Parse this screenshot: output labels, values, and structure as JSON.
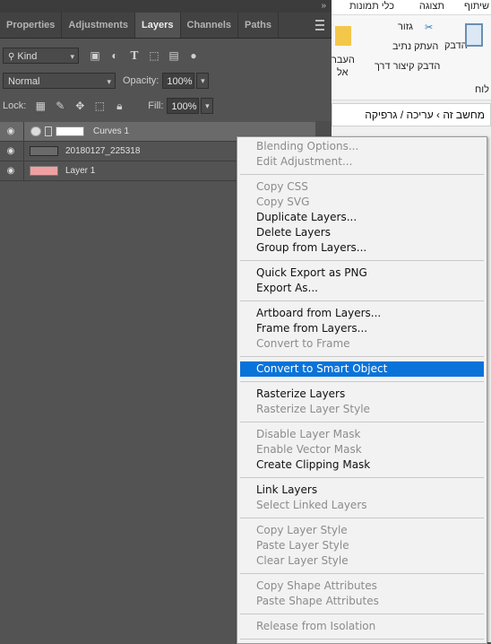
{
  "panel_tabs": [
    "Properties",
    "Adjustments",
    "Layers",
    "Channels",
    "Paths"
  ],
  "active_tab": "Layers",
  "filter": {
    "label": "Kind"
  },
  "blend_mode": "Normal",
  "opacity": {
    "label": "Opacity:",
    "value": "100%"
  },
  "lock": {
    "label": "Lock:"
  },
  "fill": {
    "label": "Fill:",
    "value": "100%"
  },
  "layers": [
    {
      "name": "Curves 1",
      "selected": true
    },
    {
      "name": "20180127_225318",
      "selected": false
    },
    {
      "name": "Layer 1",
      "selected": false
    }
  ],
  "explorer": {
    "tabs": [
      "שיתוף",
      "תצוגה",
      "כלי תמונות"
    ],
    "cut": "גזור",
    "copy_path": "העתק נתיב",
    "paste_shortcut": "הדבק קיצור דרך",
    "paste": "הדבק",
    "move_to": "העבר",
    "move_to_2": "אל",
    "clipboard": "לוח",
    "address": "מחשב זה  ›  עריכה / גרפיקה"
  },
  "menu": [
    {
      "label": "Blending Options...",
      "enabled": false
    },
    {
      "label": "Edit Adjustment...",
      "enabled": false
    },
    {
      "sep": true
    },
    {
      "label": "Copy CSS",
      "enabled": false
    },
    {
      "label": "Copy SVG",
      "enabled": false
    },
    {
      "label": "Duplicate Layers...",
      "enabled": true
    },
    {
      "label": "Delete Layers",
      "enabled": true
    },
    {
      "label": "Group from Layers...",
      "enabled": true
    },
    {
      "sep": true
    },
    {
      "label": "Quick Export as PNG",
      "enabled": true
    },
    {
      "label": "Export As...",
      "enabled": true
    },
    {
      "sep": true
    },
    {
      "label": "Artboard from Layers...",
      "enabled": true
    },
    {
      "label": "Frame from Layers...",
      "enabled": true
    },
    {
      "label": "Convert to Frame",
      "enabled": false
    },
    {
      "sep": true
    },
    {
      "label": "Convert to Smart Object",
      "enabled": true,
      "highlighted": true
    },
    {
      "sep": true
    },
    {
      "label": "Rasterize Layers",
      "enabled": true
    },
    {
      "label": "Rasterize Layer Style",
      "enabled": false
    },
    {
      "sep": true
    },
    {
      "label": "Disable Layer Mask",
      "enabled": false
    },
    {
      "label": "Enable Vector Mask",
      "enabled": false
    },
    {
      "label": "Create Clipping Mask",
      "enabled": true
    },
    {
      "sep": true
    },
    {
      "label": "Link Layers",
      "enabled": true
    },
    {
      "label": "Select Linked Layers",
      "enabled": false
    },
    {
      "sep": true
    },
    {
      "label": "Copy Layer Style",
      "enabled": false
    },
    {
      "label": "Paste Layer Style",
      "enabled": false
    },
    {
      "label": "Clear Layer Style",
      "enabled": false
    },
    {
      "sep": true
    },
    {
      "label": "Copy Shape Attributes",
      "enabled": false
    },
    {
      "label": "Paste Shape Attributes",
      "enabled": false
    },
    {
      "sep": true
    },
    {
      "label": "Release from Isolation",
      "enabled": false
    },
    {
      "sep": true
    }
  ],
  "colors": {
    "highlight": "#0a73d9",
    "layer1_thumb": "#f0a0a0"
  }
}
